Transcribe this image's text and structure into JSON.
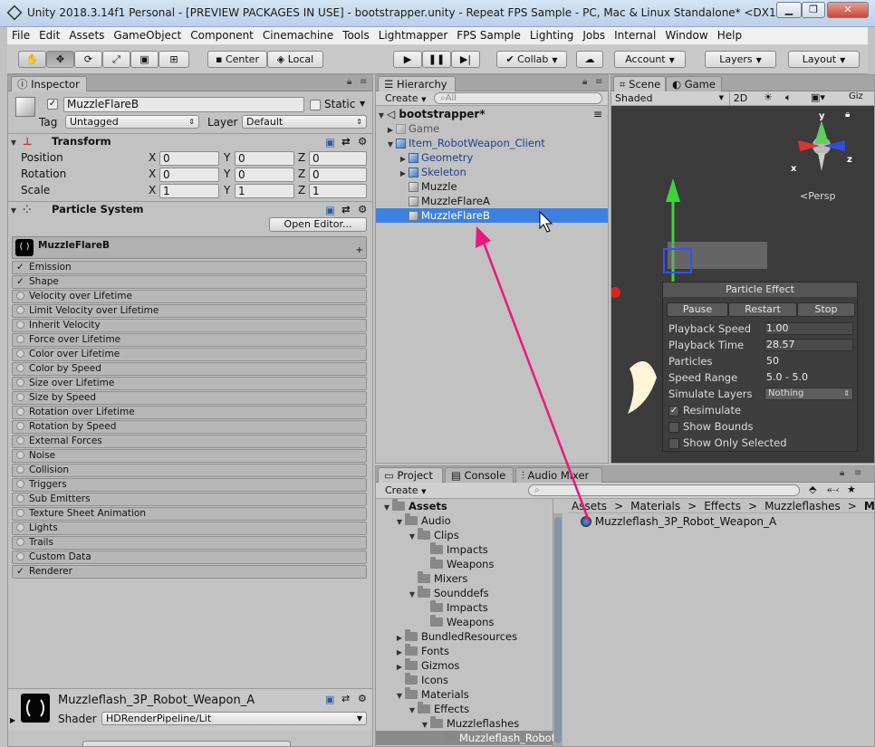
{
  "window": {
    "title": "Unity 2018.3.14f1 Personal - [PREVIEW PACKAGES IN USE] - bootstrapper.unity - Repeat FPS Sample - PC, Mac & Linux Standalone* <DX11>",
    "minimize": "▁",
    "maximize": "❐",
    "close": "✕"
  },
  "menu": [
    "File",
    "Edit",
    "Assets",
    "GameObject",
    "Component",
    "Cinemachine",
    "Tools",
    "Lightmapper",
    "FPS Sample",
    "Lighting",
    "Jobs",
    "Internal",
    "Window",
    "Help"
  ],
  "toolbar": {
    "tools": [
      "hand",
      "move",
      "rotate",
      "scale",
      "rect",
      "transform"
    ],
    "center": "Center",
    "local": "Local",
    "collab": "Collab",
    "account": "Account",
    "layers": "Layers",
    "layout": "Layout",
    "play": "▶",
    "pause": "❚❚",
    "step": "▶|"
  },
  "inspector": {
    "tab": "Inspector",
    "object_name": "MuzzleFlareB",
    "static_label": "Static",
    "tag_label": "Tag",
    "tag_value": "Untagged",
    "layer_label": "Layer",
    "layer_value": "Default",
    "transform": {
      "title": "Transform",
      "rows": [
        {
          "label": "Position",
          "x": "0",
          "y": "0",
          "z": "0"
        },
        {
          "label": "Rotation",
          "x": "0",
          "y": "0",
          "z": "0"
        },
        {
          "label": "Scale",
          "x": "1",
          "y": "1",
          "z": "1"
        }
      ],
      "x": "X",
      "y": "Y",
      "z": "Z"
    },
    "particle_system": {
      "title": "Particle System",
      "open_editor": "Open Editor...",
      "name": "MuzzleFlareB",
      "plus": "+",
      "modules": [
        {
          "label": "Emission",
          "checked": true
        },
        {
          "label": "Shape",
          "checked": true
        },
        {
          "label": "Velocity over Lifetime",
          "checked": false
        },
        {
          "label": "Limit Velocity over Lifetime",
          "checked": false
        },
        {
          "label": "Inherit Velocity",
          "checked": false
        },
        {
          "label": "Force over Lifetime",
          "checked": false
        },
        {
          "label": "Color over Lifetime",
          "checked": false
        },
        {
          "label": "Color by Speed",
          "checked": false
        },
        {
          "label": "Size over Lifetime",
          "checked": false
        },
        {
          "label": "Size by Speed",
          "checked": false
        },
        {
          "label": "Rotation over Lifetime",
          "checked": false
        },
        {
          "label": "Rotation by Speed",
          "checked": false
        },
        {
          "label": "External Forces",
          "checked": false
        },
        {
          "label": "Noise",
          "checked": false
        },
        {
          "label": "Collision",
          "checked": false
        },
        {
          "label": "Triggers",
          "checked": false
        },
        {
          "label": "Sub Emitters",
          "checked": false
        },
        {
          "label": "Texture Sheet Animation",
          "checked": false
        },
        {
          "label": "Lights",
          "checked": false
        },
        {
          "label": "Trails",
          "checked": false
        },
        {
          "label": "Custom Data",
          "checked": false
        },
        {
          "label": "Renderer",
          "checked": true
        }
      ]
    },
    "material": {
      "name": "Muzzleflash_3P_Robot_Weapon_A",
      "shader_label": "Shader",
      "shader_value": "HDRenderPipeline/Lit"
    }
  },
  "hierarchy": {
    "tab": "Hierarchy",
    "create": "Create",
    "search_placeholder": "All",
    "scene": "bootstrapper*",
    "items": [
      {
        "label": "Game",
        "indent": 1,
        "expand": "▶",
        "icon": "grey",
        "color": "#555555"
      },
      {
        "label": "Item_RobotWeapon_Client",
        "indent": 1,
        "expand": "▼",
        "icon": "blue",
        "color": "#1d3f8a"
      },
      {
        "label": "Geometry",
        "indent": 2,
        "expand": "▶",
        "icon": "blue",
        "color": "#1d3f8a"
      },
      {
        "label": "Skeleton",
        "indent": 2,
        "expand": "▶",
        "icon": "blue",
        "color": "#1d3f8a"
      },
      {
        "label": "Muzzle",
        "indent": 2,
        "expand": "",
        "icon": "fx",
        "color": "#111111"
      },
      {
        "label": "MuzzleFlareA",
        "indent": 2,
        "expand": "",
        "icon": "fx",
        "color": "#111111"
      },
      {
        "label": "MuzzleFlareB",
        "indent": 2,
        "expand": "",
        "icon": "fx",
        "color": "#ffffff",
        "selected": true
      }
    ]
  },
  "scene_view": {
    "tabs": [
      "Scene",
      "Game"
    ],
    "shading": "Shaded",
    "mode_2d": "2D",
    "persp": "Persp",
    "axes": {
      "y": "y",
      "x": "x",
      "z": "z"
    },
    "effect": {
      "title": "Particle Effect",
      "pause": "Pause",
      "restart": "Restart",
      "stop": "Stop",
      "rows": [
        {
          "label": "Playback Speed",
          "value": "1.00",
          "boxed": true
        },
        {
          "label": "Playback Time",
          "value": "28.57",
          "boxed": true
        },
        {
          "label": "Particles",
          "value": "50",
          "boxed": false
        },
        {
          "label": "Speed Range",
          "value": "5.0 - 5.0",
          "boxed": false
        },
        {
          "label": "Simulate Layers",
          "value": "Nothing",
          "boxed": "dropdown"
        }
      ],
      "checks": [
        {
          "label": "Resimulate",
          "checked": true
        },
        {
          "label": "Show Bounds",
          "checked": false
        },
        {
          "label": "Show Only Selected",
          "checked": false
        }
      ]
    }
  },
  "project": {
    "tabs": [
      "Project",
      "Console",
      "Audio Mixer"
    ],
    "create": "Create",
    "tree": [
      {
        "label": "Assets",
        "indent": 0,
        "expand": "▼",
        "bold": true
      },
      {
        "label": "Audio",
        "indent": 1,
        "expand": "▼"
      },
      {
        "label": "Clips",
        "indent": 2,
        "expand": "▼"
      },
      {
        "label": "Impacts",
        "indent": 3,
        "expand": ""
      },
      {
        "label": "Weapons",
        "indent": 3,
        "expand": ""
      },
      {
        "label": "Mixers",
        "indent": 2,
        "expand": ""
      },
      {
        "label": "Sounddefs",
        "indent": 2,
        "expand": "▼"
      },
      {
        "label": "Impacts",
        "indent": 3,
        "expand": ""
      },
      {
        "label": "Weapons",
        "indent": 3,
        "expand": ""
      },
      {
        "label": "BundledResources",
        "indent": 1,
        "expand": "▶"
      },
      {
        "label": "Fonts",
        "indent": 1,
        "expand": "▶"
      },
      {
        "label": "Gizmos",
        "indent": 1,
        "expand": "▶"
      },
      {
        "label": "Icons",
        "indent": 1,
        "expand": ""
      },
      {
        "label": "Materials",
        "indent": 1,
        "expand": "▼"
      },
      {
        "label": "Effects",
        "indent": 2,
        "expand": "▼"
      },
      {
        "label": "Muzzleflashes",
        "indent": 3,
        "expand": "▼"
      },
      {
        "label": "Muzzleflash_Robot",
        "indent": 4,
        "expand": "",
        "selected": true
      }
    ],
    "breadcrumb": [
      "Assets",
      "Materials",
      "Effects",
      "Muzzleflashes",
      "Muzzle"
    ],
    "breadcrumb_sep": ">",
    "asset": "Muzzleflash_3P_Robot_Weapon_A"
  },
  "colors": {
    "annotation_arrow": "#e8197a",
    "selection": "#3d80df"
  }
}
